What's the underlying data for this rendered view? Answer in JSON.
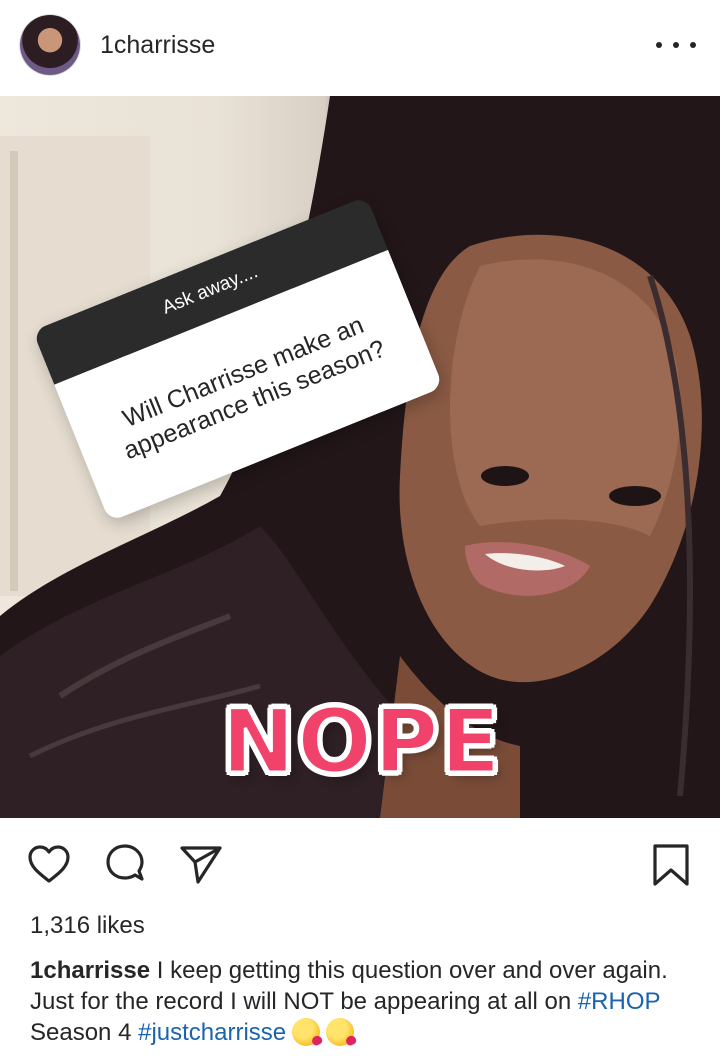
{
  "post": {
    "username": "1charrisse",
    "question_sticker": {
      "header": "Ask away....",
      "question": "Will Charrisse make an appearance this season?"
    },
    "nope_sticker": "NOPE",
    "likes": "1,316 likes",
    "caption": {
      "username": "1charrisse",
      "text_part1": " I keep getting this question over and over again. Just for the record I will NOT be appearing at all on ",
      "hashtag1": "#RHOP",
      "text_part2": " Season 4 ",
      "hashtag2": "#justcharrisse"
    }
  },
  "icons": {
    "more": "more-options-icon",
    "like": "heart-icon",
    "comment": "comment-icon",
    "share": "paper-plane-icon",
    "save": "bookmark-icon",
    "emoji": "kissing-heart-emoji"
  },
  "colors": {
    "hashtag": "#1a63b0",
    "nope_fill": "#f0426a",
    "text": "#262626"
  }
}
